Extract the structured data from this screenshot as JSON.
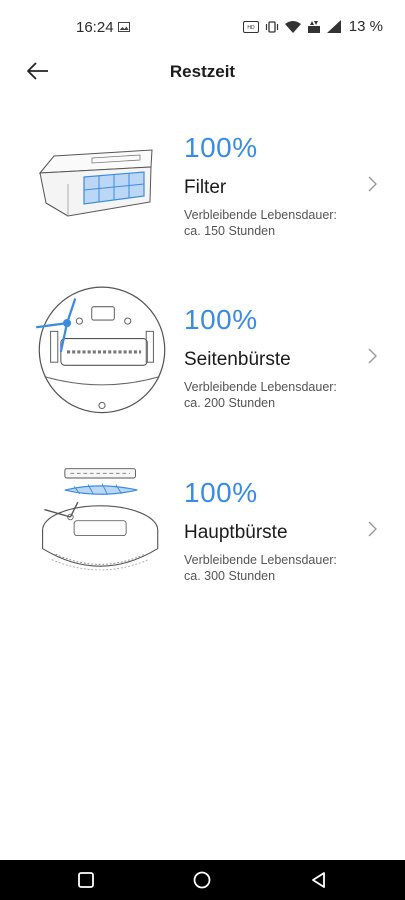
{
  "status_bar": {
    "time": "16:24",
    "battery": "13 %",
    "icons": [
      "gallery-icon",
      "volte-icon",
      "vibrate-icon",
      "wifi-icon",
      "data-icon",
      "signal-icon"
    ]
  },
  "header": {
    "title": "Restzeit",
    "back_icon": "arrow-left-icon"
  },
  "items": [
    {
      "percent": "100%",
      "title": "Filter",
      "label_line1": "Verbleibende Lebensdauer:",
      "label_line2": "ca. 150 Stunden",
      "image": "filter-image"
    },
    {
      "percent": "100%",
      "title": "Seitenbürste",
      "label_line1": "Verbleibende Lebensdauer:",
      "label_line2": "ca. 200 Stunden",
      "image": "side-brush-image"
    },
    {
      "percent": "100%",
      "title": "Hauptbürste",
      "label_line1": "Verbleibende Lebensdauer:",
      "label_line2": "ca. 300 Stunden",
      "image": "main-brush-image"
    }
  ],
  "navbar": {
    "buttons": [
      "recents-square-icon",
      "home-circle-icon",
      "back-triangle-icon"
    ]
  },
  "colors": {
    "accent": "#3b8ce0",
    "text": "#1a1a1a",
    "secondary_text": "#555555",
    "navbar": "#000000"
  }
}
